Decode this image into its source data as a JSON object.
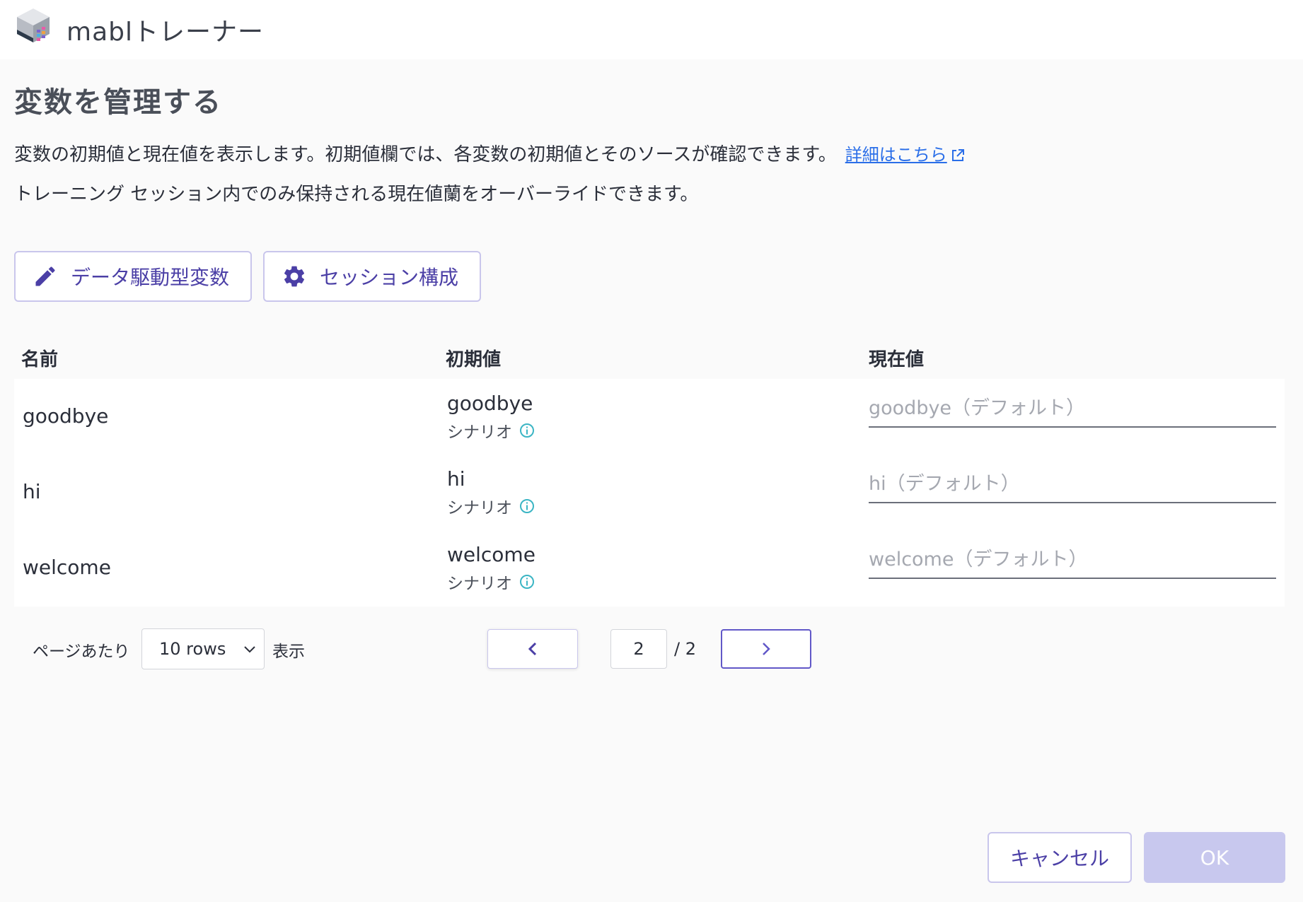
{
  "app": {
    "title": "mablトレーナー"
  },
  "page": {
    "title": "変数を管理する",
    "description_line1": "変数の初期値と現在値を表示します。初期値欄では、各変数の初期値とそのソースが確認できます。",
    "details_link": "詳細はこちら",
    "description_line2": "トレーニング セッション内でのみ保持される現在値蘭をオーバーライドできます。"
  },
  "toolbar": {
    "data_driven_label": "データ駆動型変数",
    "session_config_label": "セッション構成"
  },
  "table": {
    "headers": {
      "name": "名前",
      "initial": "初期値",
      "current": "現在値"
    },
    "rows": [
      {
        "name": "goodbye",
        "initial": "goodbye",
        "source": "シナリオ",
        "current_value": "",
        "current_placeholder": "goodbye（デフォルト）"
      },
      {
        "name": "hi",
        "initial": "hi",
        "source": "シナリオ",
        "current_value": "",
        "current_placeholder": "hi（デフォルト）"
      },
      {
        "name": "welcome",
        "initial": "welcome",
        "source": "シナリオ",
        "current_value": "",
        "current_placeholder": "welcome（デフォルト）"
      }
    ]
  },
  "pagination": {
    "per_page_label": "ページあたり",
    "rows_selected": "10 rows",
    "show_label": "表示",
    "current_page": "2",
    "total_pages": "/ 2"
  },
  "footer": {
    "cancel_label": "キャンセル",
    "ok_label": "OK"
  },
  "colors": {
    "accent": "#4b3fa6",
    "link": "#2a6ee8",
    "info": "#3bb5c4",
    "ok_disabled": "#c8c8ee"
  },
  "icons": [
    "mabl-logo-icon",
    "external-link-icon",
    "pencil-icon",
    "gear-icon",
    "info-icon",
    "chevron-down-icon",
    "chevron-left-icon",
    "chevron-right-icon"
  ]
}
